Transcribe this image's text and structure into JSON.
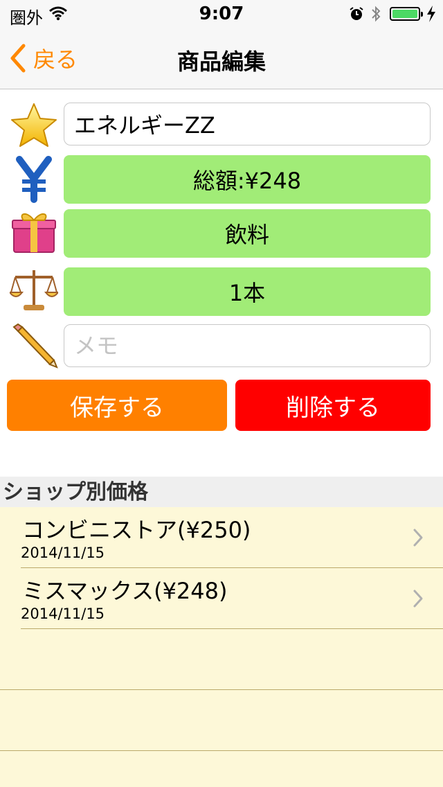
{
  "status_bar": {
    "carrier": "圏外",
    "time": "9:07",
    "icons": [
      "wifi-icon",
      "alarm-icon",
      "bluetooth-icon",
      "battery-icon",
      "charging-icon"
    ]
  },
  "nav": {
    "back_label": "戻る",
    "title": "商品編集"
  },
  "form": {
    "name_value": "エネルギーZZ",
    "total_label": "総額:¥248",
    "category_label": "飲料",
    "quantity_label": "1本",
    "memo_value": "",
    "memo_placeholder": "メモ",
    "icons": [
      "star-icon",
      "yen-icon",
      "gift-icon",
      "scale-icon",
      "pencil-icon"
    ]
  },
  "actions": {
    "save_label": "保存する",
    "delete_label": "削除する"
  },
  "shop_section": {
    "header": "ショップ別価格",
    "rows": [
      {
        "name": "コンビニストア(¥250)",
        "date": "2014/11/15"
      },
      {
        "name": "ミスマックス(¥248)",
        "date": "2014/11/15"
      }
    ]
  },
  "colors": {
    "accent": "#ff8800",
    "green_button": "#a1ec77",
    "save": "#ff8000",
    "delete": "#ff0000",
    "list_background": "#fdf8d8"
  }
}
